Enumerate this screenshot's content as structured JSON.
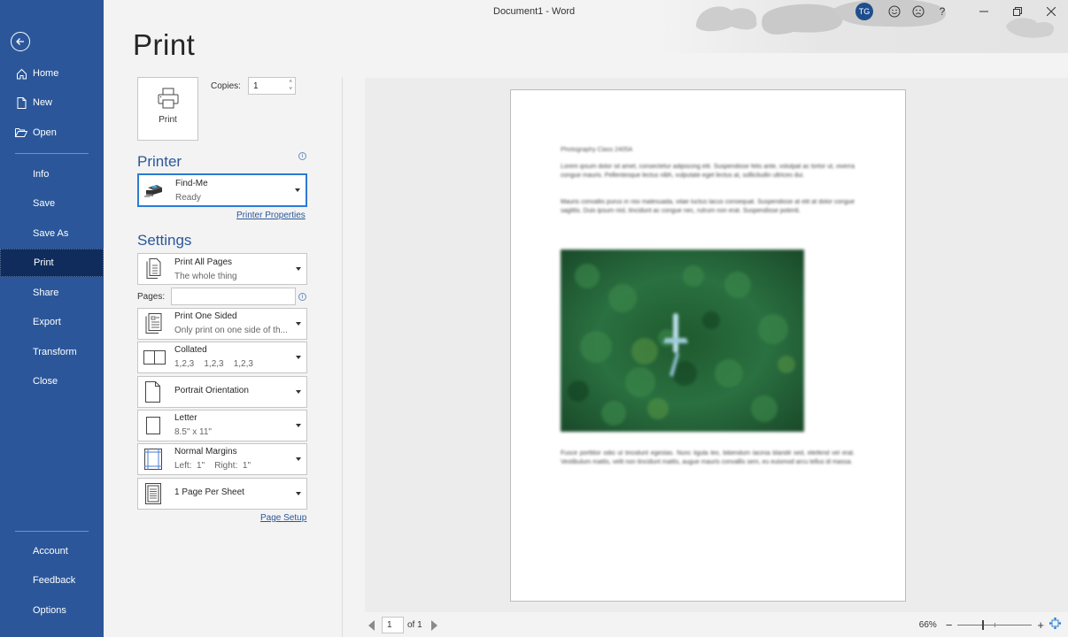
{
  "window": {
    "title": "Document1 - Word",
    "user_initials": "TG",
    "icons": [
      "smiley-icon",
      "frown-icon",
      "help-icon",
      "minimize-icon",
      "restore-icon",
      "close-icon"
    ],
    "help_label": "?",
    "accent": "#2b579a"
  },
  "sidebar": {
    "back_icon": "arrow-left-circle-icon",
    "items_top": [
      {
        "label": "Home",
        "icon": "home-icon"
      },
      {
        "label": "New",
        "icon": "new-doc-icon"
      },
      {
        "label": "Open",
        "icon": "folder-open-icon"
      }
    ],
    "items_mid": [
      {
        "label": "Info"
      },
      {
        "label": "Save"
      },
      {
        "label": "Save As"
      },
      {
        "label": "Print",
        "active": true
      },
      {
        "label": "Share"
      },
      {
        "label": "Export"
      },
      {
        "label": "Transform"
      },
      {
        "label": "Close"
      }
    ],
    "items_bottom": [
      {
        "label": "Account"
      },
      {
        "label": "Feedback"
      },
      {
        "label": "Options"
      }
    ],
    "colors": {
      "background": "#2b579a",
      "active": "#0f2c5c"
    }
  },
  "print": {
    "title": "Print",
    "print_button_label": "Print",
    "copies_label": "Copies:",
    "copies_value": "1"
  },
  "printer": {
    "heading": "Printer",
    "name": "Find-Me",
    "status": "Ready",
    "properties_link": "Printer Properties"
  },
  "settings": {
    "heading": "Settings",
    "pages_label": "Pages:",
    "pages_value": "",
    "dropdowns": [
      {
        "line1": "Print All Pages",
        "line2": "The whole thing",
        "icon": "document-pages-icon"
      },
      {
        "line1": "Print One Sided",
        "line2": "Only print on one side of th...",
        "icon": "one-sided-icon"
      },
      {
        "line1": "Collated",
        "line2": "1,2,3    1,2,3    1,2,3",
        "icon": "collated-icon"
      },
      {
        "line1": "Portrait Orientation",
        "line2": "",
        "icon": "portrait-icon"
      },
      {
        "line1": "Letter",
        "line2": "8.5\" x 11\"",
        "icon": "paper-size-icon"
      },
      {
        "line1": "Normal Margins",
        "line2": "Left:  1\"    Right:  1\"",
        "icon": "margins-icon"
      },
      {
        "line1": "1 Page Per Sheet",
        "line2": "",
        "icon": "pages-per-sheet-icon"
      }
    ],
    "page_setup_link": "Page Setup"
  },
  "preview": {
    "doc_title": "Photography Class 2405A",
    "paragraphs": [
      "Lorem ipsum dolor sit amet, consectetur adipiscing elit. Suspendisse felis ante, volutpat ac tortor ut, viverra congue mauris. Pellentesque lectus nibh, vulputate eget lectus at, sollicitudin ultrices dui.",
      "Mauris convallis purus in nisi malesuada, vitae luctus lacus consequat. Suspendisse at elit at dolor congue sagittis. Duis ipsum nisl, tincidunt ac congue nec, rutrum non erat. Suspendisse potenti.",
      "Fusce porttitor odio ut tincidunt egestas. Nunc ligula leo, bibendum lacinia blandit sed, eleifend vel erat. Vestibulum mattis, velit non tincidunt mattis, augue mauris convallis sem, eu euismod arcu tellus id massa."
    ],
    "image_description": "aerial-forest-airplane-image",
    "current_page": "1",
    "page_of": "of 1",
    "zoom_level": "66%",
    "zoom_fraction": 0.33
  }
}
